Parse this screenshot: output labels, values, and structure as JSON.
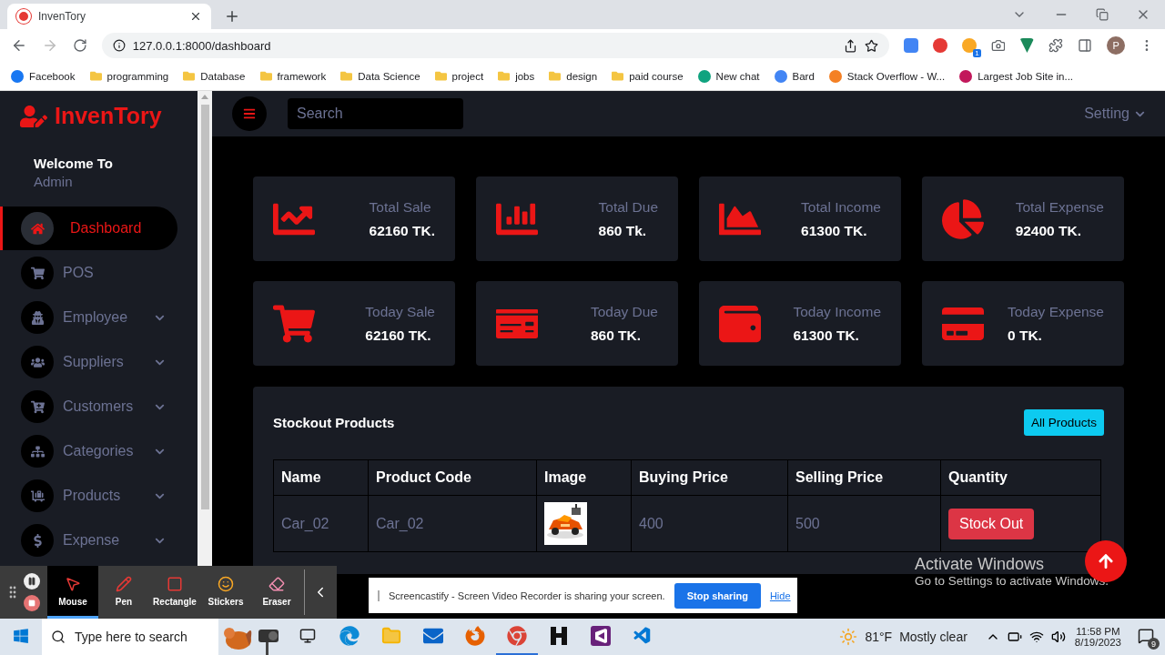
{
  "browser": {
    "tab": {
      "title": "InvenTory"
    },
    "url": "127.0.0.1:8000/dashboard",
    "extension_badge": "1",
    "profile_initial": "P",
    "bookmarks": [
      {
        "label": "Facebook",
        "kind": "site",
        "color": "#1877f2"
      },
      {
        "label": "programming",
        "kind": "folder"
      },
      {
        "label": "Database",
        "kind": "folder"
      },
      {
        "label": "framework",
        "kind": "folder"
      },
      {
        "label": "Data Science",
        "kind": "folder"
      },
      {
        "label": "project",
        "kind": "folder"
      },
      {
        "label": "jobs",
        "kind": "folder"
      },
      {
        "label": "design",
        "kind": "folder"
      },
      {
        "label": "paid course",
        "kind": "folder"
      },
      {
        "label": "New chat",
        "kind": "site",
        "color": "#10a37f"
      },
      {
        "label": "Bard",
        "kind": "site",
        "color": "#4285f4"
      },
      {
        "label": "Stack Overflow - W...",
        "kind": "site",
        "color": "#f48024"
      },
      {
        "label": "Largest Job Site in...",
        "kind": "site",
        "color": "#c2185b"
      }
    ]
  },
  "sidebar": {
    "brand": "InvenTory",
    "welcome": "Welcome To",
    "user": "Admin",
    "items": [
      {
        "label": "Dashboard",
        "selected": true,
        "kind": "link"
      },
      {
        "label": "POS",
        "selected": false,
        "kind": "link"
      },
      {
        "label": "Employee",
        "selected": false,
        "kind": "group"
      },
      {
        "label": "Suppliers",
        "selected": false,
        "kind": "group"
      },
      {
        "label": "Customers",
        "selected": false,
        "kind": "group"
      },
      {
        "label": "Categories",
        "selected": false,
        "kind": "group"
      },
      {
        "label": "Products",
        "selected": false,
        "kind": "group"
      },
      {
        "label": "Expense",
        "selected": false,
        "kind": "group"
      }
    ]
  },
  "topbar": {
    "search": {
      "placeholder": "Search"
    },
    "setting": "Setting"
  },
  "cards": [
    {
      "label": "Total Sale",
      "value": "62160 TK."
    },
    {
      "label": "Total Due",
      "value": "860 Tk."
    },
    {
      "label": "Total Income",
      "value": "61300 TK."
    },
    {
      "label": "Total Expense",
      "value": "92400 TK."
    },
    {
      "label": "Today Sale",
      "value": "62160 TK."
    },
    {
      "label": "Today Due",
      "value": "860 TK."
    },
    {
      "label": "Today Income",
      "value": "61300 TK."
    },
    {
      "label": "Today Expense",
      "value": "0 TK."
    }
  ],
  "stockout": {
    "title": "Stockout Products",
    "button": "All Products",
    "columns": [
      "Name",
      "Product Code",
      "Image",
      "Buying Price",
      "Selling Price",
      "Quantity"
    ],
    "rows": [
      {
        "name": "Car_02",
        "code": "Car_02",
        "buying_price": "400",
        "selling_price": "500",
        "action": "Stock Out"
      }
    ]
  },
  "screen_recorder": {
    "tools": [
      {
        "label": "Mouse",
        "selected": true
      },
      {
        "label": "Pen",
        "selected": false
      },
      {
        "label": "Rectangle",
        "selected": false
      },
      {
        "label": "Stickers",
        "selected": false
      },
      {
        "label": "Eraser",
        "selected": false
      }
    ],
    "banner": {
      "message": "Screencastify - Screen Video Recorder is sharing your screen.",
      "stop": "Stop sharing",
      "hide": "Hide"
    }
  },
  "activation": {
    "title": "Activate Windows",
    "message": "Go to Settings to activate Windows."
  },
  "taskbar": {
    "search": {
      "placeholder": "Type here to search"
    },
    "temperature": "81°F",
    "condition": "Mostly clear",
    "time": "11:58 PM",
    "date": "8/19/2023",
    "notifications": "9"
  }
}
